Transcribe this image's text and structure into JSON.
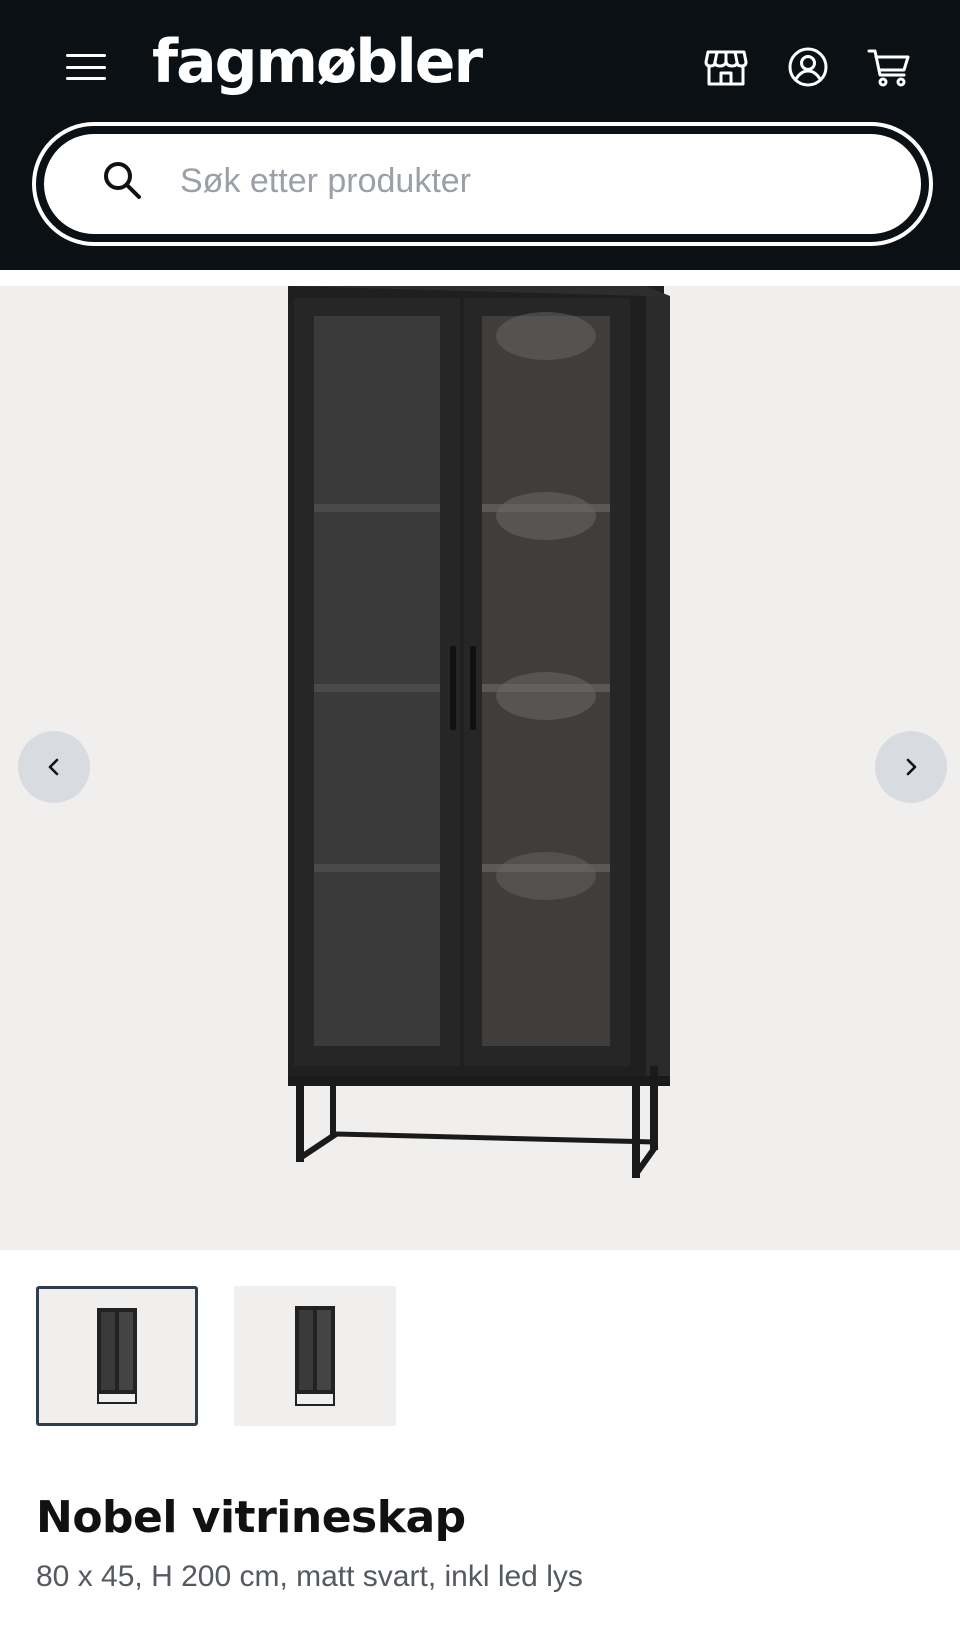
{
  "header": {
    "logo_text": "fagmøbler",
    "menu_icon": "hamburger-menu-icon",
    "icons": [
      "store-icon",
      "account-icon",
      "cart-icon"
    ],
    "background_color": "#0b1014"
  },
  "search": {
    "placeholder": "Søk etter produkter",
    "icon": "search-icon"
  },
  "gallery": {
    "background_color": "#f1efed",
    "prev_icon": "chevron-left-icon",
    "next_icon": "chevron-right-icon",
    "thumbnail_count": 2,
    "active_thumbnail": 1
  },
  "product": {
    "title": "Nobel vitrineskap",
    "subtitle": "80 x 45, H 200 cm, matt svart, inkl led lys"
  }
}
